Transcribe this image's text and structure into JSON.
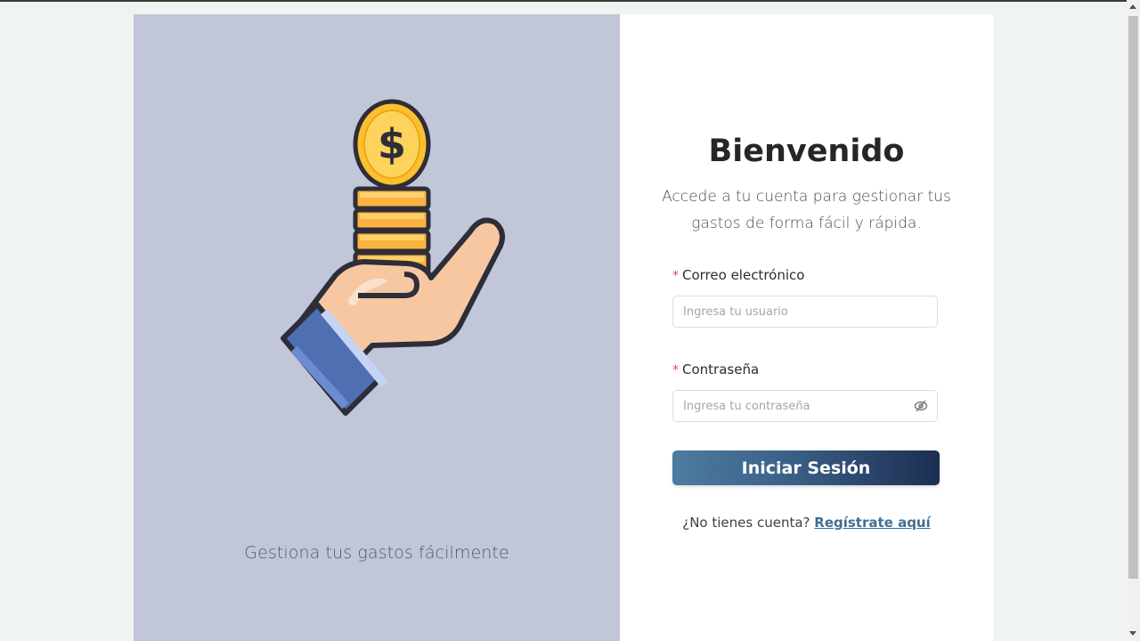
{
  "hero": {
    "caption": "Gestiona tus gastos fácilmente"
  },
  "login": {
    "title": "Bienvenido",
    "subtitle": "Accede a tu cuenta para gestionar tus gastos de forma fácil y rápida.",
    "email_label": "Correo electrónico",
    "email_placeholder": "Ingresa tu usuario",
    "email_value": "",
    "password_label": "Contraseña",
    "password_placeholder": "Ingresa tu contraseña",
    "password_value": "",
    "required_mark": "*",
    "submit_label": "Iniciar Sesión",
    "signup_prompt": "¿No tienes cuenta?",
    "signup_link": "Regístrate aquí"
  },
  "icons": {
    "illustration": "hand-holding-coins-icon",
    "password_toggle": "eye-off-icon"
  },
  "colors": {
    "page_bg": "#eff3f2",
    "hero_bg": "#c1c6d9",
    "button_start": "#4d7ba1",
    "button_end": "#1c2d52",
    "link": "#3f6f95",
    "required": "#e04848"
  }
}
